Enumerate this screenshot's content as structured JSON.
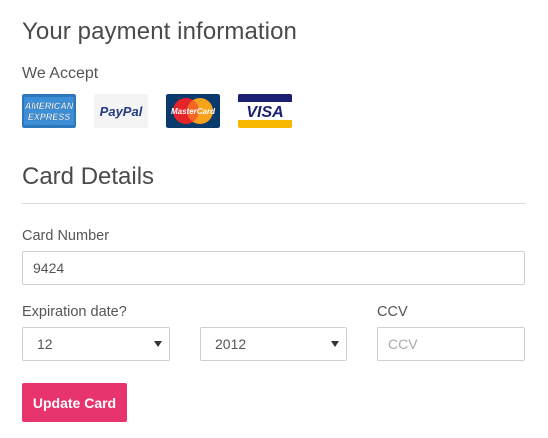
{
  "header": {
    "title": "Your payment information",
    "accept_label": "We Accept"
  },
  "accepted_cards": [
    {
      "name": "American Express",
      "logo_text": [
        "AMERICAN",
        "EXPRESS"
      ],
      "color": "#2e77bc"
    },
    {
      "name": "PayPal",
      "logo_text": "PayPal",
      "color": "#253b80"
    },
    {
      "name": "MasterCard",
      "logo_text": "MasterCard",
      "color": "#eb001b"
    },
    {
      "name": "Visa",
      "logo_text": "VISA",
      "color": "#1a1f71"
    }
  ],
  "card_details": {
    "title": "Card Details",
    "card_number": {
      "label": "Card Number",
      "value": "9424"
    },
    "expiration": {
      "label": "Expiration date?",
      "month": "12",
      "year": "2012"
    },
    "ccv": {
      "label": "CCV",
      "value": "",
      "placeholder": "CCV"
    },
    "submit_label": "Update Card"
  },
  "colors": {
    "accent": "#e8346c",
    "text": "#4a4a4a",
    "border": "#cfcfcf"
  }
}
